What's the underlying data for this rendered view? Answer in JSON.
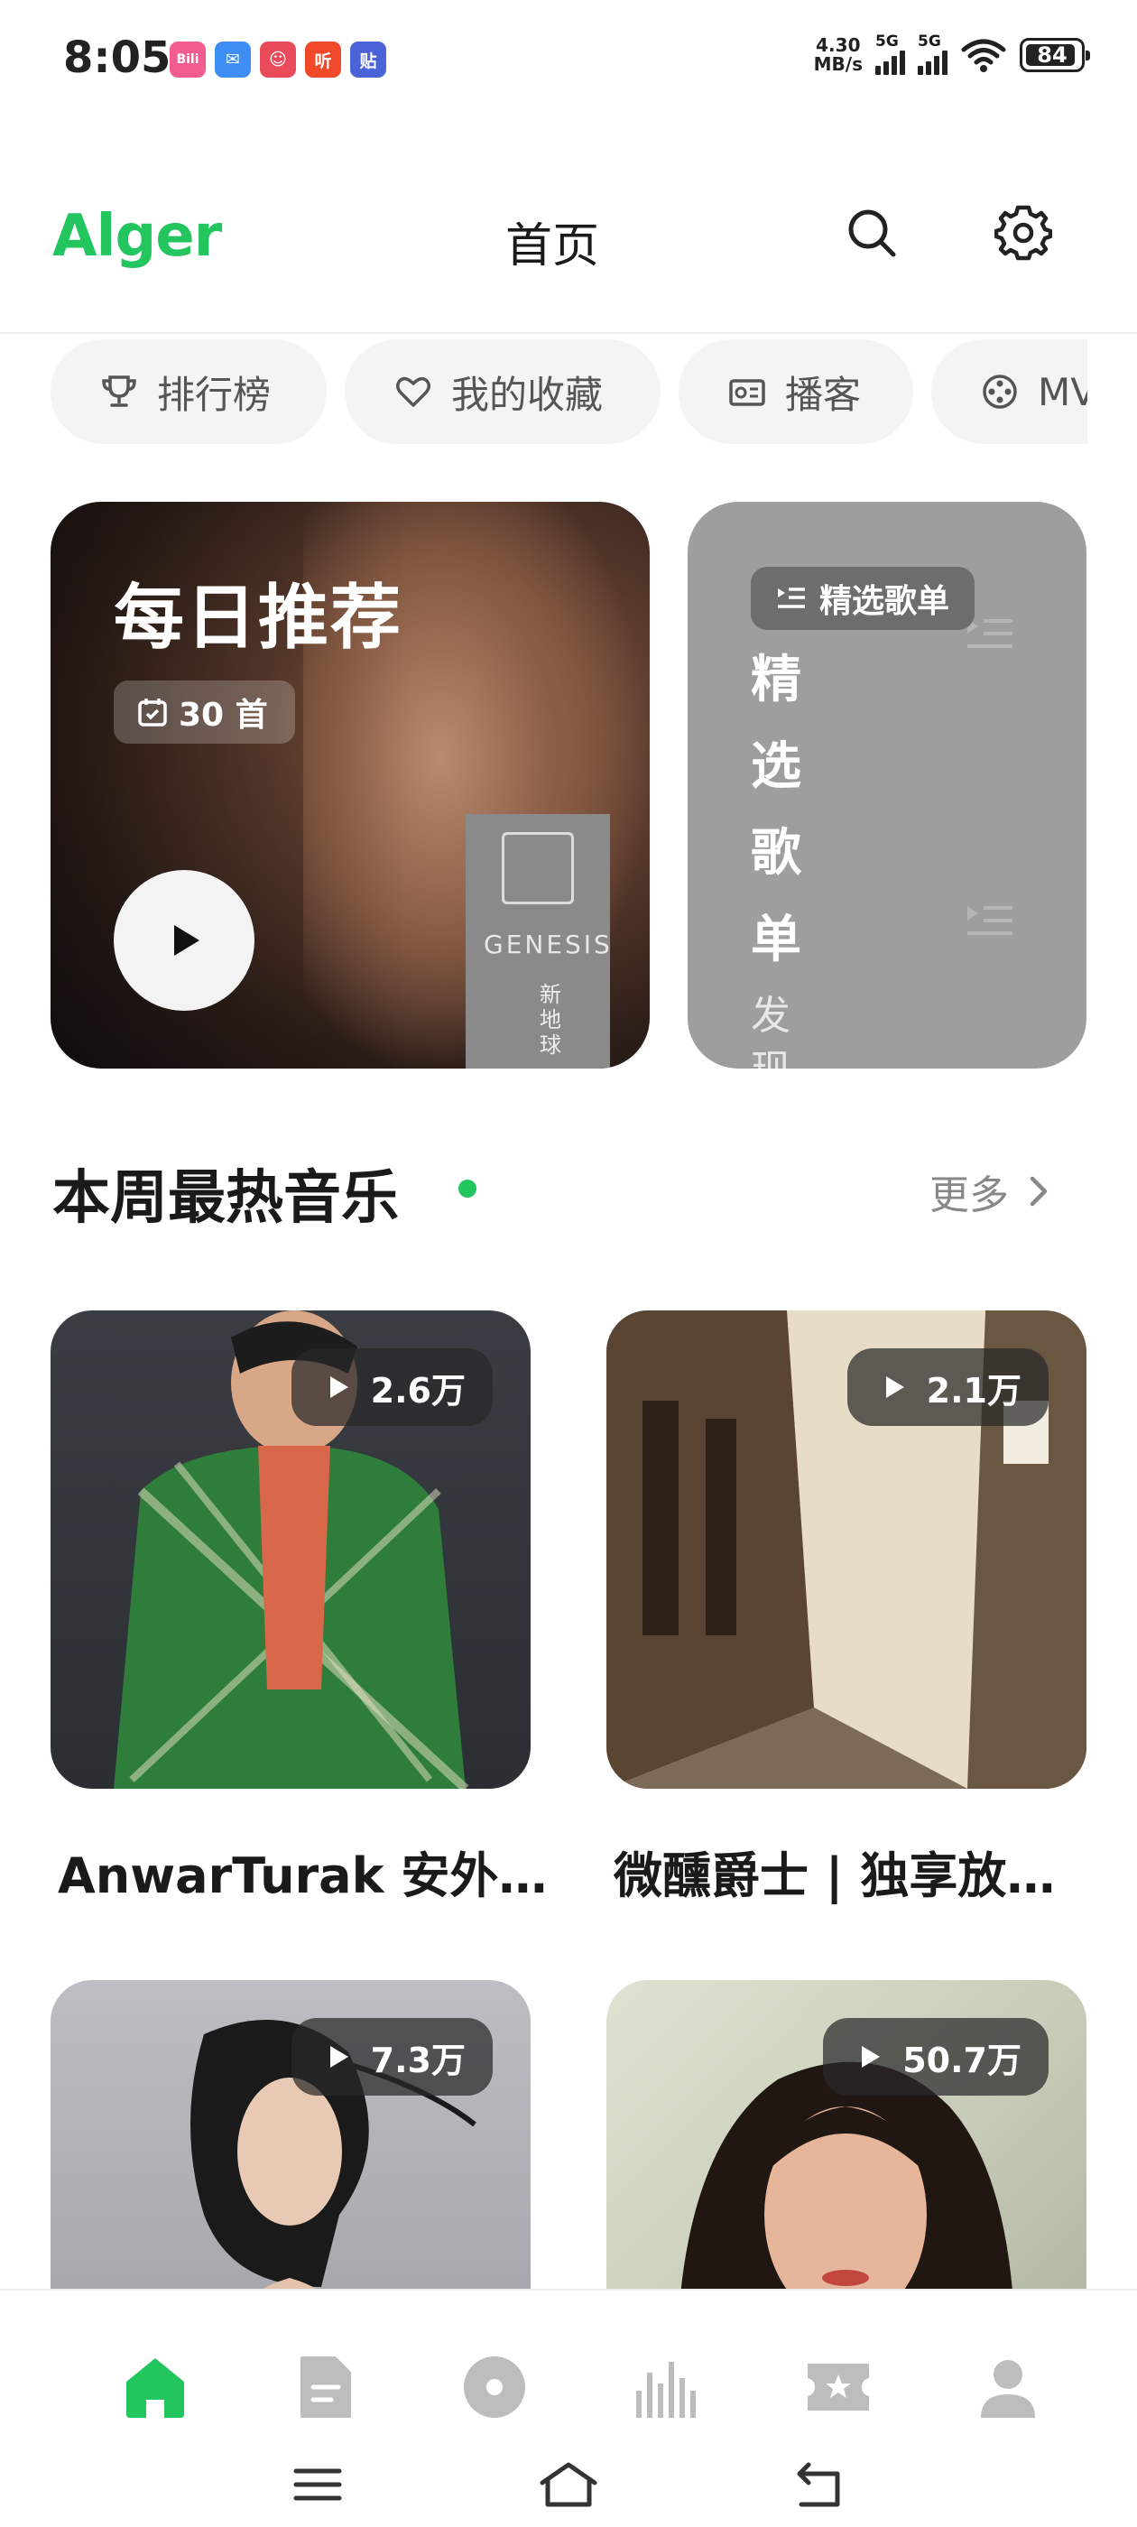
{
  "status_bar": {
    "time": "8:05",
    "net_speed_value": "4.30",
    "net_speed_unit": "MB/s",
    "signal1_label": "5G",
    "signal2_label": "5G",
    "battery": "84",
    "app_icons": [
      {
        "name": "bilibili-icon",
        "glyph": "Bili",
        "color": "#f25d8e"
      },
      {
        "name": "mail-icon",
        "glyph": "✉",
        "color": "#3f8ef5"
      },
      {
        "name": "game-icon",
        "glyph": "☺",
        "color": "#ea4b5a"
      },
      {
        "name": "ting-icon",
        "glyph": "听",
        "color": "#f04a2a"
      },
      {
        "name": "tieba-icon",
        "glyph": "贴",
        "color": "#4a63d8"
      }
    ]
  },
  "header": {
    "logo": "Alger",
    "title": "首页",
    "accent_color": "#22c55e"
  },
  "chips": [
    {
      "label": "排行榜",
      "icon": "trophy-icon"
    },
    {
      "label": "我的收藏",
      "icon": "heart-icon"
    },
    {
      "label": "播客",
      "icon": "radio-icon"
    },
    {
      "label": "MV",
      "icon": "film-reel-icon"
    }
  ],
  "daily": {
    "title": "每日推荐",
    "count": "30 首",
    "album_text": "GENESIS",
    "album_cn": "新地球"
  },
  "picked": {
    "badge": "精选歌单",
    "vertical_chars": [
      "精",
      "选",
      "歌",
      "单"
    ],
    "sub_chars": [
      "发",
      "现"
    ]
  },
  "hot_section": {
    "title": "本周最热音乐",
    "more": "更多"
  },
  "playlists": [
    {
      "name": "AnwarTurak 安外…",
      "plays": "2.6万"
    },
    {
      "name": "微醺爵士 | 独享放…",
      "plays": "2.1万"
    },
    {
      "name": "",
      "plays": "7.3万"
    },
    {
      "name": "",
      "plays": "50.7万"
    }
  ],
  "bottom_nav": {
    "items": [
      "home-icon",
      "document-icon",
      "disc-icon",
      "chart-bars-icon",
      "ticket-star-icon",
      "user-icon"
    ],
    "active_index": 0
  }
}
